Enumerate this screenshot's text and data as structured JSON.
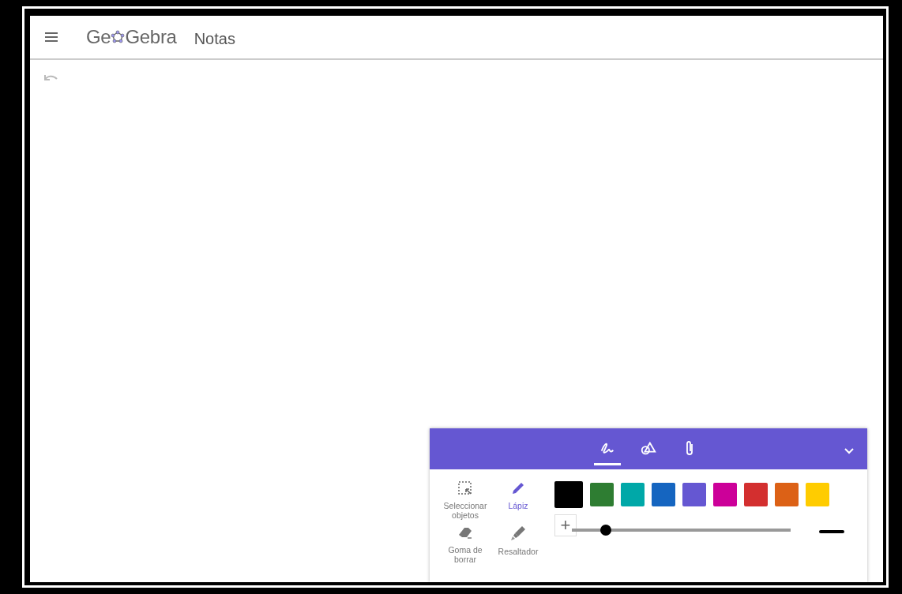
{
  "header": {
    "logo": {
      "before": "Ge",
      "after": "Gebra"
    },
    "title": "Notas"
  },
  "panel": {
    "tabs": [
      {
        "kind": "pen",
        "selected": true
      },
      {
        "kind": "shapes",
        "selected": false
      },
      {
        "kind": "attach",
        "selected": false
      }
    ],
    "tools": [
      {
        "kind": "select",
        "label": "Seleccionar objetos",
        "selected": false
      },
      {
        "kind": "pen",
        "label": "Lápiz",
        "selected": true
      },
      {
        "kind": "eraser",
        "label": "Goma de borrar",
        "selected": false
      },
      {
        "kind": "highlighter",
        "label": "Resaltador",
        "selected": false
      }
    ],
    "colors": [
      {
        "color": "#000000",
        "selected": true
      },
      {
        "color": "#2e7d32",
        "selected": false
      },
      {
        "color": "#00a8a8",
        "selected": false
      },
      {
        "color": "#1565c0",
        "selected": false
      },
      {
        "color": "#6557d2",
        "selected": false
      },
      {
        "color": "#cc0099",
        "selected": false
      },
      {
        "color": "#d32f2f",
        "selected": false
      },
      {
        "color": "#dc6116",
        "selected": false
      },
      {
        "color": "#ffcc00",
        "selected": false
      }
    ],
    "plus": "+",
    "thickness": {
      "level": 0.155
    }
  }
}
